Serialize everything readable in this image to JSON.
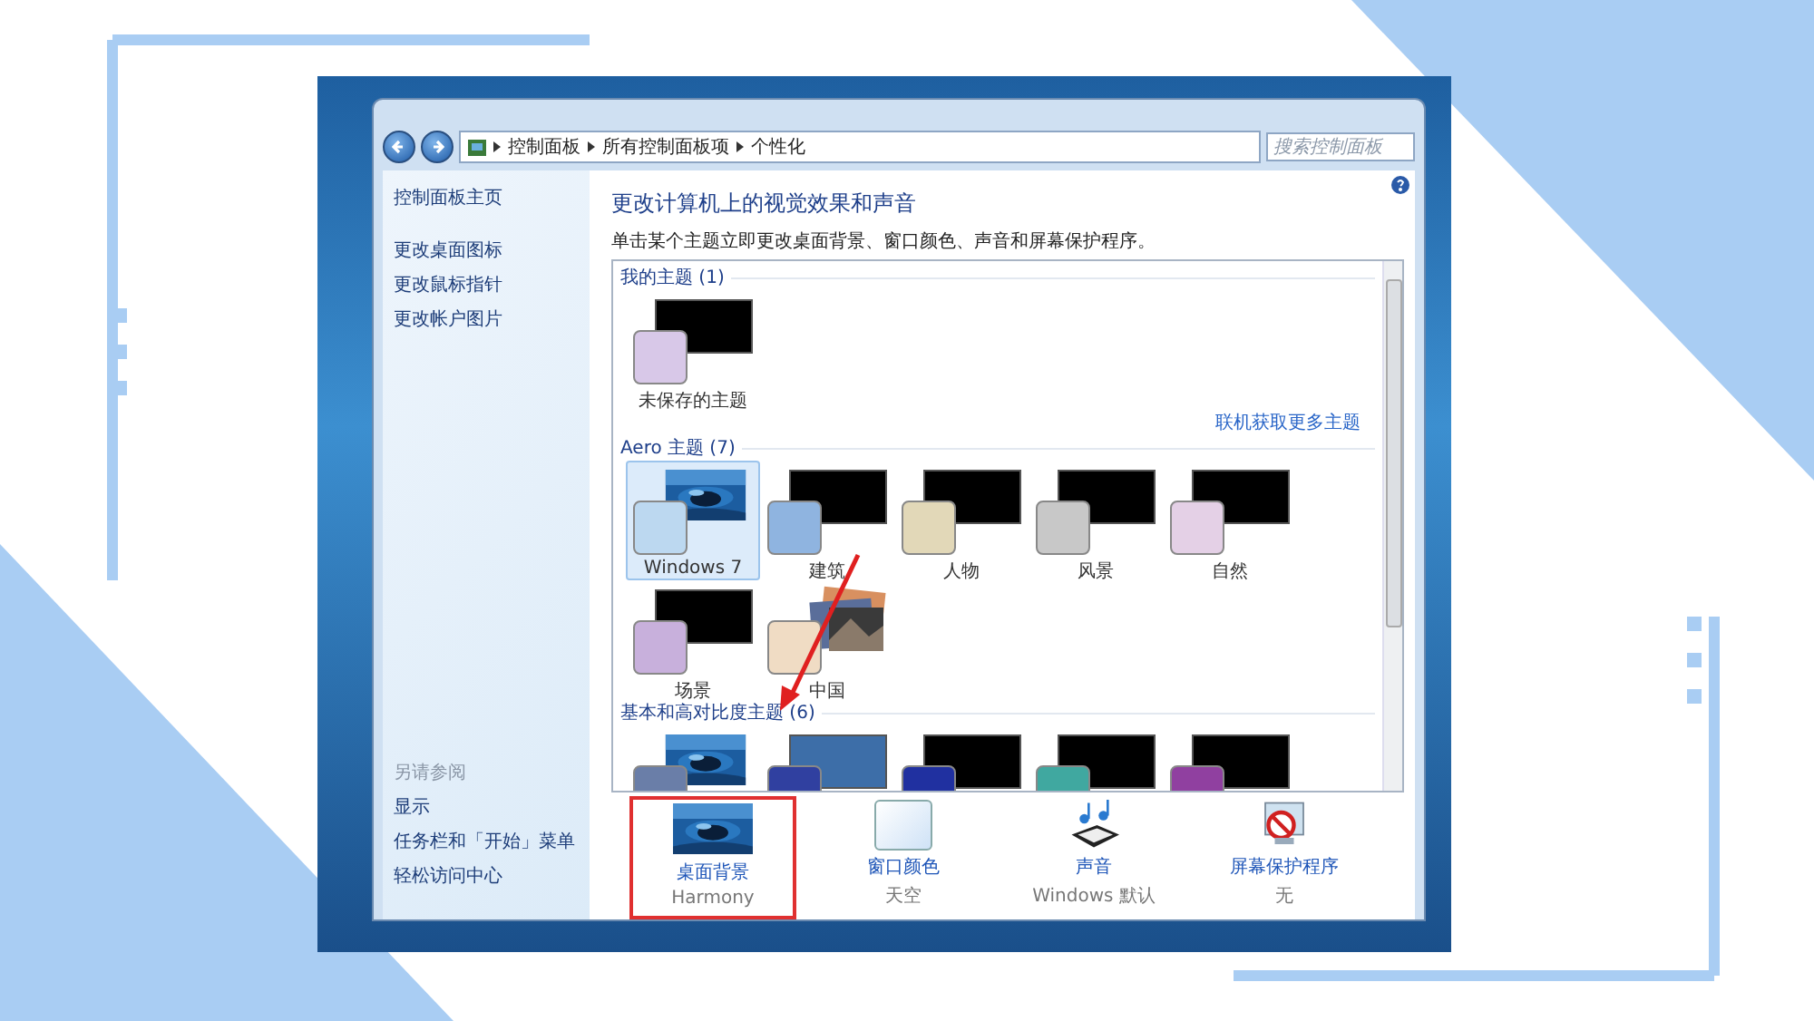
{
  "nav": {
    "breadcrumb": [
      "控制面板",
      "所有控制面板项",
      "个性化"
    ],
    "search": {
      "placeholder": "搜索控制面板"
    }
  },
  "sidebar": {
    "links": [
      "控制面板主页",
      "更改桌面图标",
      "更改鼠标指针",
      "更改帐户图片"
    ],
    "see_also": {
      "title": "另请参阅",
      "links": [
        "显示",
        "任务栏和「开始」菜单",
        "轻松访问中心"
      ]
    }
  },
  "main": {
    "title": "更改计算机上的视觉效果和声音",
    "description": "单击某个主题立即更改桌面背景、窗口颜色、声音和屏幕保护程序。",
    "groups": [
      {
        "title": "我的主题 (1)",
        "link": "联机获取更多主题",
        "themes": [
          {
            "name": "未保存的主题",
            "kind": "black",
            "color": "#d8c8e8",
            "selected": false
          }
        ]
      },
      {
        "title": "Aero 主题 (7)",
        "themes": [
          {
            "name": "Windows 7",
            "kind": "picture",
            "color": "#bcd8f0",
            "selected": true
          },
          {
            "name": "建筑",
            "kind": "black",
            "color": "#8fb4e0",
            "selected": false
          },
          {
            "name": "人物",
            "kind": "black",
            "color": "#e2d8b8",
            "selected": false
          },
          {
            "name": "风景",
            "kind": "black",
            "color": "#c8c8c8",
            "selected": false
          },
          {
            "name": "自然",
            "kind": "black",
            "color": "#e4d0e6",
            "selected": false
          },
          {
            "name": "场景",
            "kind": "black",
            "color": "#c8b0dc",
            "selected": false
          },
          {
            "name": "中国",
            "kind": "slideshow",
            "color": "#f0dcc4",
            "selected": false
          }
        ]
      },
      {
        "title": "基本和高对比度主题 (6)",
        "themes": [
          {
            "kind": "picture",
            "color": "#6a7ea8",
            "selected": false
          },
          {
            "kind": "blue",
            "color": "#3040a0",
            "selected": false
          },
          {
            "kind": "black",
            "color": "#2030a0",
            "selected": false
          },
          {
            "kind": "black",
            "color": "#40a8a0",
            "selected": false
          },
          {
            "kind": "black",
            "color": "#9040a0",
            "selected": false
          }
        ]
      }
    ]
  },
  "settings": [
    {
      "kind": "background",
      "label": "桌面背景",
      "value": "Harmony",
      "highlighted": true
    },
    {
      "kind": "color",
      "label": "窗口颜色",
      "value": "天空",
      "highlighted": false
    },
    {
      "kind": "sound",
      "label": "声音",
      "value": "Windows 默认",
      "highlighted": false
    },
    {
      "kind": "screensaver",
      "label": "屏幕保护程序",
      "value": "无",
      "highlighted": false
    }
  ]
}
